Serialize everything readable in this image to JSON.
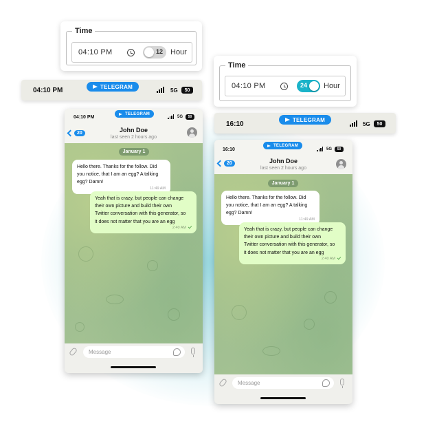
{
  "time_cards": [
    {
      "legend": "Time",
      "value": "04:10 PM",
      "toggle_value": "12",
      "toggle_on": false,
      "hour_label": "Hour"
    },
    {
      "legend": "Time",
      "value": "04:10 PM",
      "toggle_value": "24",
      "toggle_on": true,
      "hour_label": "Hour"
    }
  ],
  "status_bars": [
    {
      "time": "04:10 PM",
      "app": "TELEGRAM",
      "network": "5G",
      "battery": "50"
    },
    {
      "time": "16:10",
      "app": "TELEGRAM",
      "network": "5G",
      "battery": "50"
    }
  ],
  "phones": [
    {
      "status": {
        "time": "04:10 PM",
        "app": "TELEGRAM",
        "network": "5G",
        "battery": "50"
      },
      "back_count": "20",
      "contact": "John Doe",
      "last_seen": "last seen 2 hours ago",
      "date_chip": "January 1",
      "messages": [
        {
          "dir": "in",
          "line1": "Hello there. Thanks for the follow. Did",
          "line2": "you notice, that I am an egg? A talking",
          "line3": "egg? Damn!",
          "time": "11:49 AM"
        },
        {
          "dir": "out",
          "line1": "Yeah that is crazy, but people can change",
          "line2": "their own picture and build their own",
          "line3": "Twitter conversation with this generator, so",
          "line4": "it does not matter that you are an egg",
          "time": "2:40 AM"
        }
      ],
      "input_placeholder": "Message"
    },
    {
      "status": {
        "time": "16:10",
        "app": "TELEGRAM",
        "network": "5G",
        "battery": "50"
      },
      "back_count": "20",
      "contact": "John Doe",
      "last_seen": "last seen 2 hours ago",
      "date_chip": "January 1",
      "messages": [
        {
          "dir": "in",
          "line1": "Hello there. Thanks for the follow. Did",
          "line2": "you notice, that I am an egg? A talking",
          "line3": "egg? Damn!",
          "time": "11:49 AM"
        },
        {
          "dir": "out",
          "line1": "Yeah that is crazy, but people can change",
          "line2": "their own picture and build their own",
          "line3": "Twitter conversation with this generator, so",
          "line4": "it does not matter that you are an egg",
          "time": "2:40 AM"
        }
      ],
      "input_placeholder": "Message"
    }
  ],
  "colors": {
    "accent": "#1a8ceb",
    "toggle_on": "#1ab3c9",
    "toggle_off": "#d6d6d6",
    "out_bubble": "#e1fdc6"
  }
}
